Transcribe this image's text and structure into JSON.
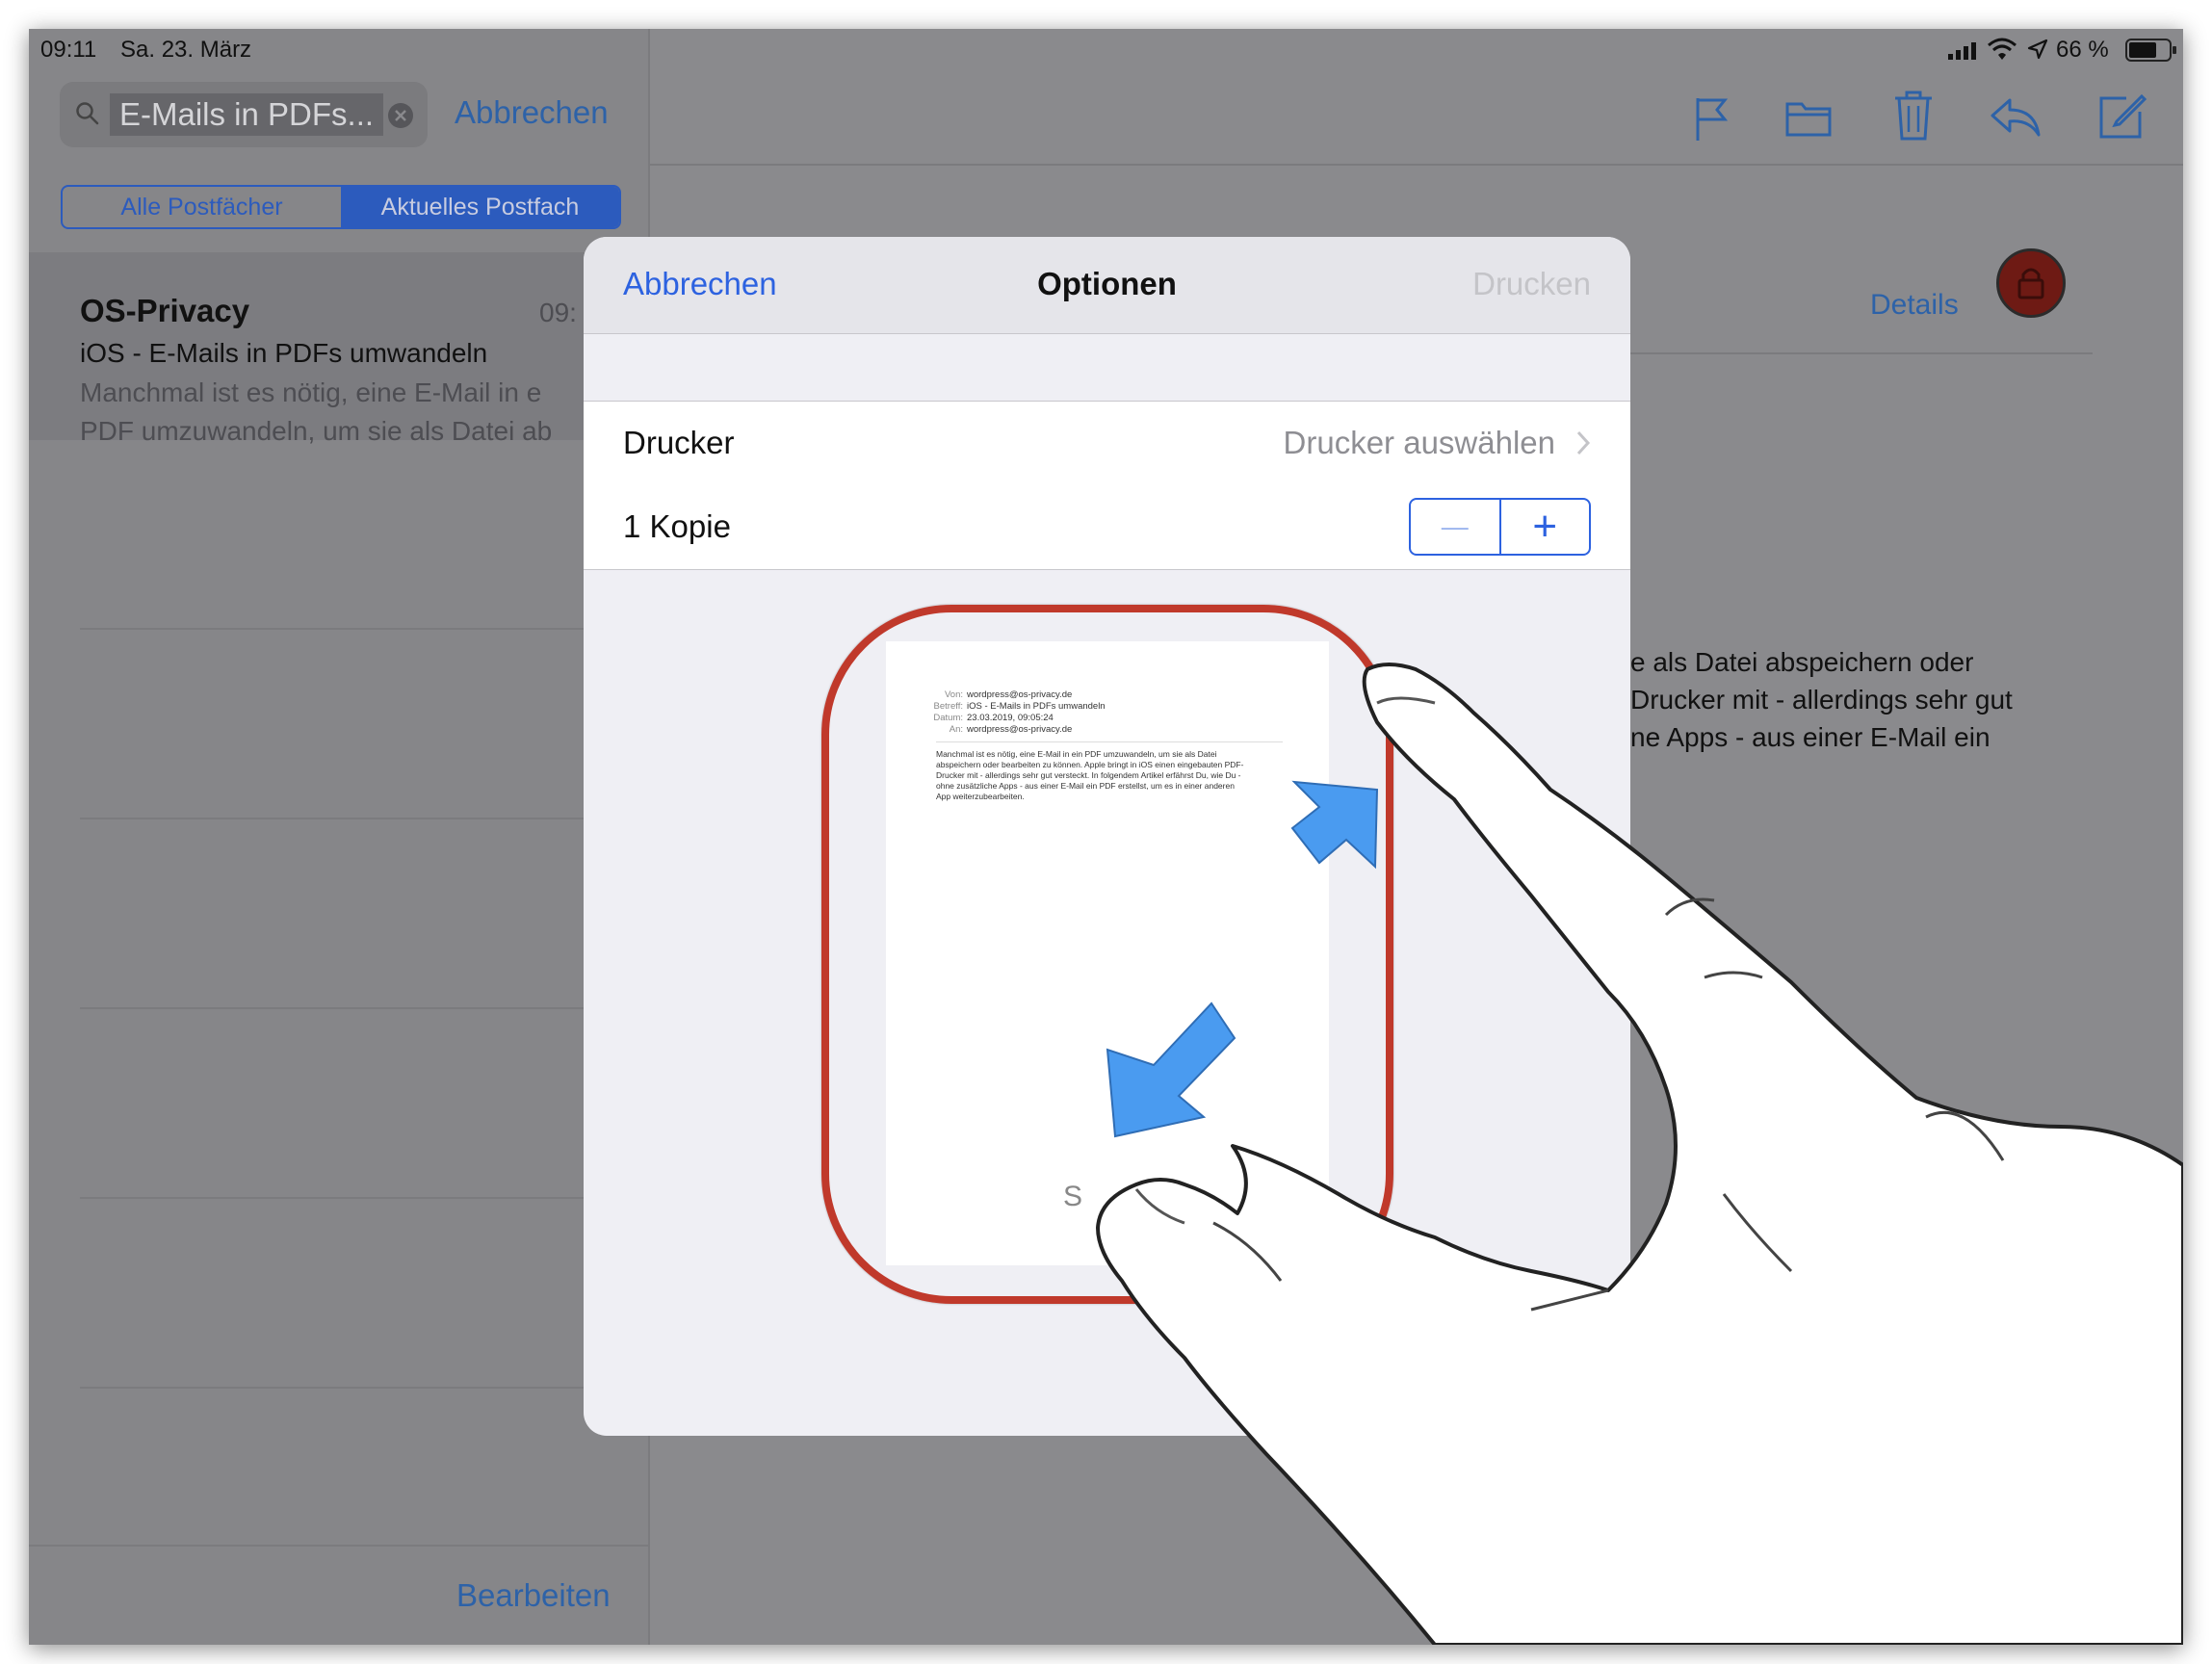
{
  "status_bar": {
    "time": "09:11",
    "date": "Sa. 23. März",
    "battery": "66 %"
  },
  "sidebar": {
    "search_value": "E-Mails in PDFs...",
    "cancel_label": "Abbrechen",
    "segments": [
      "Alle Postfächer",
      "Aktuelles Postfach"
    ],
    "selected_segment": "Aktuelles Postfach",
    "message": {
      "sender": "OS-Privacy",
      "time": "09:",
      "subject": "iOS - E-Mails in PDFs umwandeln",
      "preview_line1": "Manchmal ist es nötig, eine E-Mail in e",
      "preview_line2": "PDF umzuwandeln, um sie als Datei ab"
    },
    "edit_label": "Bearbeiten"
  },
  "toolbar": {
    "icons": [
      "flag-icon",
      "folder-icon",
      "trash-icon",
      "reply-icon",
      "compose-icon"
    ]
  },
  "detail": {
    "details_label": "Details",
    "body_line1": "e als Datei abspeichern oder",
    "body_line2": "Drucker mit - allerdings sehr gut",
    "body_line3": "ne Apps - aus einer E-Mail ein"
  },
  "modal": {
    "cancel_label": "Abbrechen",
    "title": "Optionen",
    "print_label": "Drucken",
    "printer_label": "Drucker",
    "printer_value": "Drucker auswählen",
    "copies_label": "1 Kopie",
    "minus_symbol": "—",
    "plus_symbol": "+"
  },
  "preview": {
    "from_label": "Von:",
    "from_value": "wordpress@os-privacy.de",
    "subject_label": "Betreff:",
    "subject_value": "iOS - E-Mails in PDFs umwandeln",
    "date_label": "Datum:",
    "date_value": "23.03.2019, 09:05:24",
    "to_label": "An:",
    "to_value": "wordpress@os-privacy.de",
    "body_line1": "Manchmal ist es nötig, eine E-Mail in ein PDF umzuwandeln, um sie als Datei",
    "body_line2": "abspeichern oder bearbeiten zu können. Apple bringt in iOS einen eingebauten PDF-",
    "body_line3": "Drucker mit - allerdings sehr gut versteckt. In folgendem Artikel erfährst Du, wie Du -",
    "body_line4": "ohne zusätzliche Apps - aus einer E-Mail ein PDF erstellst, um es in einer anderen",
    "body_line5": "App weiterzubearbeiten.",
    "footer_char": "S"
  },
  "colors": {
    "accent": "#2d62e0",
    "dimmed_accent": "#2d62a8",
    "highlight_frame": "#c0392b",
    "arrow": "#4a9bf0"
  }
}
